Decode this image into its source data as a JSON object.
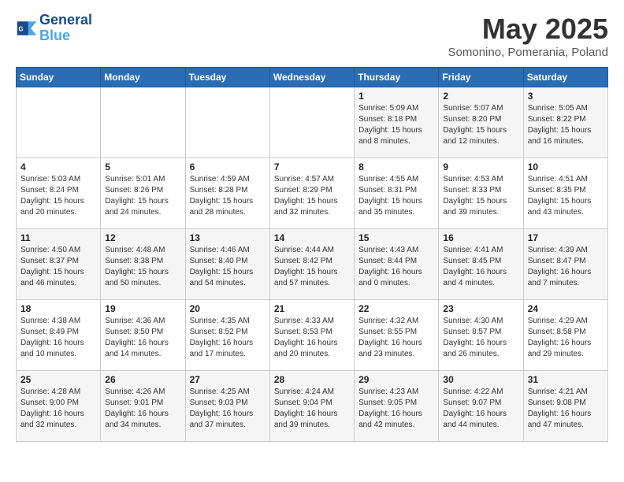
{
  "header": {
    "logo_line1": "General",
    "logo_line2": "Blue",
    "month": "May 2025",
    "location": "Somonino, Pomerania, Poland"
  },
  "weekdays": [
    "Sunday",
    "Monday",
    "Tuesday",
    "Wednesday",
    "Thursday",
    "Friday",
    "Saturday"
  ],
  "weeks": [
    [
      {
        "day": "",
        "info": ""
      },
      {
        "day": "",
        "info": ""
      },
      {
        "day": "",
        "info": ""
      },
      {
        "day": "",
        "info": ""
      },
      {
        "day": "1",
        "info": "Sunrise: 5:09 AM\nSunset: 8:18 PM\nDaylight: 15 hours\nand 8 minutes."
      },
      {
        "day": "2",
        "info": "Sunrise: 5:07 AM\nSunset: 8:20 PM\nDaylight: 15 hours\nand 12 minutes."
      },
      {
        "day": "3",
        "info": "Sunrise: 5:05 AM\nSunset: 8:22 PM\nDaylight: 15 hours\nand 16 minutes."
      }
    ],
    [
      {
        "day": "4",
        "info": "Sunrise: 5:03 AM\nSunset: 8:24 PM\nDaylight: 15 hours\nand 20 minutes."
      },
      {
        "day": "5",
        "info": "Sunrise: 5:01 AM\nSunset: 8:26 PM\nDaylight: 15 hours\nand 24 minutes."
      },
      {
        "day": "6",
        "info": "Sunrise: 4:59 AM\nSunset: 8:28 PM\nDaylight: 15 hours\nand 28 minutes."
      },
      {
        "day": "7",
        "info": "Sunrise: 4:57 AM\nSunset: 8:29 PM\nDaylight: 15 hours\nand 32 minutes."
      },
      {
        "day": "8",
        "info": "Sunrise: 4:55 AM\nSunset: 8:31 PM\nDaylight: 15 hours\nand 35 minutes."
      },
      {
        "day": "9",
        "info": "Sunrise: 4:53 AM\nSunset: 8:33 PM\nDaylight: 15 hours\nand 39 minutes."
      },
      {
        "day": "10",
        "info": "Sunrise: 4:51 AM\nSunset: 8:35 PM\nDaylight: 15 hours\nand 43 minutes."
      }
    ],
    [
      {
        "day": "11",
        "info": "Sunrise: 4:50 AM\nSunset: 8:37 PM\nDaylight: 15 hours\nand 46 minutes."
      },
      {
        "day": "12",
        "info": "Sunrise: 4:48 AM\nSunset: 8:38 PM\nDaylight: 15 hours\nand 50 minutes."
      },
      {
        "day": "13",
        "info": "Sunrise: 4:46 AM\nSunset: 8:40 PM\nDaylight: 15 hours\nand 54 minutes."
      },
      {
        "day": "14",
        "info": "Sunrise: 4:44 AM\nSunset: 8:42 PM\nDaylight: 15 hours\nand 57 minutes."
      },
      {
        "day": "15",
        "info": "Sunrise: 4:43 AM\nSunset: 8:44 PM\nDaylight: 16 hours\nand 0 minutes."
      },
      {
        "day": "16",
        "info": "Sunrise: 4:41 AM\nSunset: 8:45 PM\nDaylight: 16 hours\nand 4 minutes."
      },
      {
        "day": "17",
        "info": "Sunrise: 4:39 AM\nSunset: 8:47 PM\nDaylight: 16 hours\nand 7 minutes."
      }
    ],
    [
      {
        "day": "18",
        "info": "Sunrise: 4:38 AM\nSunset: 8:49 PM\nDaylight: 16 hours\nand 10 minutes."
      },
      {
        "day": "19",
        "info": "Sunrise: 4:36 AM\nSunset: 8:50 PM\nDaylight: 16 hours\nand 14 minutes."
      },
      {
        "day": "20",
        "info": "Sunrise: 4:35 AM\nSunset: 8:52 PM\nDaylight: 16 hours\nand 17 minutes."
      },
      {
        "day": "21",
        "info": "Sunrise: 4:33 AM\nSunset: 8:53 PM\nDaylight: 16 hours\nand 20 minutes."
      },
      {
        "day": "22",
        "info": "Sunrise: 4:32 AM\nSunset: 8:55 PM\nDaylight: 16 hours\nand 23 minutes."
      },
      {
        "day": "23",
        "info": "Sunrise: 4:30 AM\nSunset: 8:57 PM\nDaylight: 16 hours\nand 26 minutes."
      },
      {
        "day": "24",
        "info": "Sunrise: 4:29 AM\nSunset: 8:58 PM\nDaylight: 16 hours\nand 29 minutes."
      }
    ],
    [
      {
        "day": "25",
        "info": "Sunrise: 4:28 AM\nSunset: 9:00 PM\nDaylight: 16 hours\nand 32 minutes."
      },
      {
        "day": "26",
        "info": "Sunrise: 4:26 AM\nSunset: 9:01 PM\nDaylight: 16 hours\nand 34 minutes."
      },
      {
        "day": "27",
        "info": "Sunrise: 4:25 AM\nSunset: 9:03 PM\nDaylight: 16 hours\nand 37 minutes."
      },
      {
        "day": "28",
        "info": "Sunrise: 4:24 AM\nSunset: 9:04 PM\nDaylight: 16 hours\nand 39 minutes."
      },
      {
        "day": "29",
        "info": "Sunrise: 4:23 AM\nSunset: 9:05 PM\nDaylight: 16 hours\nand 42 minutes."
      },
      {
        "day": "30",
        "info": "Sunrise: 4:22 AM\nSunset: 9:07 PM\nDaylight: 16 hours\nand 44 minutes."
      },
      {
        "day": "31",
        "info": "Sunrise: 4:21 AM\nSunset: 9:08 PM\nDaylight: 16 hours\nand 47 minutes."
      }
    ]
  ]
}
